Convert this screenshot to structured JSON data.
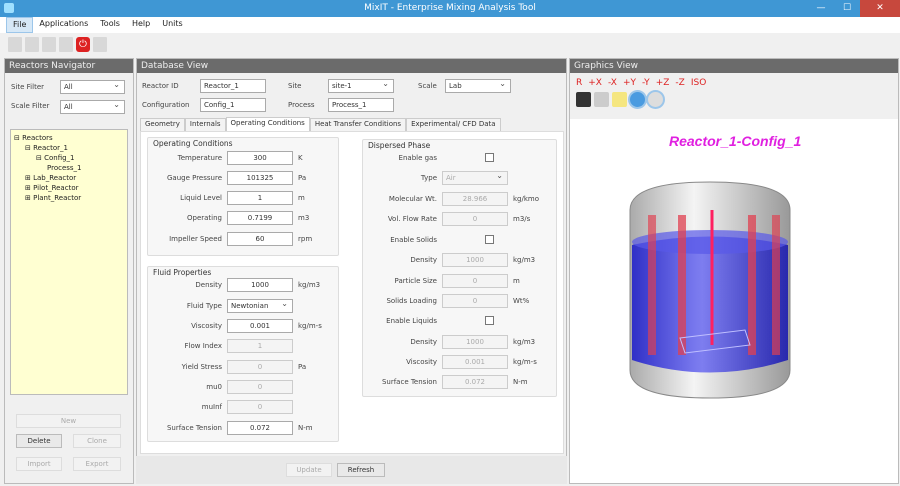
{
  "window": {
    "title": "MixIT - Enterprise Mixing Analysis Tool",
    "min": "—",
    "max": "☐",
    "close": "✕"
  },
  "menu": [
    "File",
    "Applications",
    "Tools",
    "Help",
    "Units"
  ],
  "toolbar_icons": [
    "new-file-icon",
    "open-folder-icon",
    "save-icon",
    "export-icon",
    "power-icon",
    "cube-icon"
  ],
  "navigator": {
    "title": "Reactors Navigator",
    "site_filter_label": "Site Filter",
    "site_filter_value": "All",
    "scale_filter_label": "Scale Filter",
    "scale_filter_value": "All",
    "tree": [
      {
        "label": "Reactors",
        "depth": 0,
        "sign": "⊟"
      },
      {
        "label": "Reactor_1",
        "depth": 1,
        "sign": "⊟"
      },
      {
        "label": "Config_1",
        "depth": 2,
        "sign": "⊟"
      },
      {
        "label": "Process_1",
        "depth": 3,
        "sign": ""
      },
      {
        "label": "Lab_Reactor",
        "depth": 1,
        "sign": "⊞"
      },
      {
        "label": "Pilot_Reactor",
        "depth": 1,
        "sign": "⊞"
      },
      {
        "label": "Plant_Reactor",
        "depth": 1,
        "sign": "⊞"
      }
    ],
    "buttons": {
      "new": "New",
      "delete": "Delete",
      "clone": "Clone",
      "import": "Import",
      "export": "Export"
    }
  },
  "database": {
    "title": "Database View",
    "reactor_id_label": "Reactor ID",
    "reactor_id": "Reactor_1",
    "site_label": "Site",
    "site": "site-1",
    "scale_label": "Scale",
    "scale": "Lab",
    "configuration_label": "Configuration",
    "configuration": "Config_1",
    "process_label": "Process",
    "process": "Process_1",
    "tabs": [
      "Geometry",
      "Internals",
      "Operating Conditions",
      "Heat Transfer Conditions",
      "Experimental/ CFD Data"
    ],
    "active_tab": "Operating Conditions",
    "operating": {
      "title": "Operating Conditions",
      "rows": [
        {
          "label": "Temperature",
          "value": "300",
          "unit": "K"
        },
        {
          "label": "Gauge Pressure",
          "value": "101325",
          "unit": "Pa"
        },
        {
          "label": "Liquid Level",
          "value": "1",
          "unit": "m"
        },
        {
          "label": "Operating",
          "value": "0.7199",
          "unit": "m3"
        },
        {
          "label": "Impeller Speed",
          "value": "60",
          "unit": "rpm"
        }
      ]
    },
    "fluid": {
      "title": "Fluid Properties",
      "rows": [
        {
          "label": "Density",
          "value": "1000",
          "unit": "kg/m3"
        },
        {
          "label": "Fluid Type",
          "value": "Newtonian",
          "unit": "",
          "type": "select"
        },
        {
          "label": "Viscosity",
          "value": "0.001",
          "unit": "kg/m-s"
        },
        {
          "label": "Flow Index",
          "value": "1",
          "unit": "",
          "disabled": true
        },
        {
          "label": "Yield Stress",
          "value": "0",
          "unit": "Pa",
          "disabled": true
        },
        {
          "label": "mu0",
          "value": "0",
          "unit": "",
          "disabled": true
        },
        {
          "label": "muInf",
          "value": "0",
          "unit": "",
          "disabled": true
        },
        {
          "label": "Surface Tension",
          "value": "0.072",
          "unit": "N-m"
        }
      ]
    },
    "dispersed": {
      "title": "Dispersed Phase",
      "rows": [
        {
          "label": "Enable gas",
          "type": "check",
          "checked": false
        },
        {
          "label": "Type",
          "value": "Air",
          "type": "select",
          "disabled": true
        },
        {
          "label": "Molecular Wt.",
          "value": "28.966",
          "unit": "kg/kmo",
          "disabled": true
        },
        {
          "label": "Vol. Flow Rate",
          "value": "0",
          "unit": "m3/s",
          "disabled": true
        },
        {
          "label": "Enable Solids",
          "type": "check",
          "checked": false
        },
        {
          "label": "Density",
          "value": "1000",
          "unit": "kg/m3",
          "disabled": true
        },
        {
          "label": "Particle Size",
          "value": "0",
          "unit": "m",
          "disabled": true
        },
        {
          "label": "Solids Loading",
          "value": "0",
          "unit": "Wt%",
          "disabled": true
        },
        {
          "label": "Enable Liquids",
          "type": "check",
          "checked": false
        },
        {
          "label": "Density",
          "value": "1000",
          "unit": "kg/m3",
          "disabled": true
        },
        {
          "label": "Viscosity",
          "value": "0.001",
          "unit": "kg/m-s",
          "disabled": true
        },
        {
          "label": "Surface Tension",
          "value": "0.072",
          "unit": "N-m",
          "disabled": true
        }
      ]
    },
    "update": "Update",
    "refresh": "Refresh"
  },
  "graphics": {
    "title": "Graphics View",
    "view_buttons": [
      "R",
      "+X",
      "-X",
      "+Y",
      "-Y",
      "+Z",
      "-Z",
      "ISO"
    ],
    "tool_icons": [
      "eyedropper-icon",
      "screenshot-icon",
      "lightbulb-icon",
      "shaded-sphere-icon",
      "flat-sphere-icon"
    ],
    "caption": "Reactor_1-Config_1",
    "caption_color": "#e020e0",
    "liquid_color": "#2020e0",
    "baffle_color": "#e04050"
  }
}
